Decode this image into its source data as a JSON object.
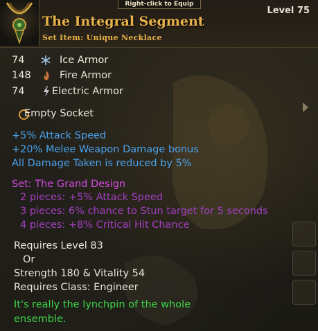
{
  "hint": "Right-click to Equip",
  "item": {
    "name": "The Integral Segment",
    "type": "Set Item: Unique Necklace",
    "level": "Level 75"
  },
  "armor": [
    {
      "value": "74",
      "icon": "snowflake-icon",
      "label": "Ice Armor",
      "color": "#9fc6e6"
    },
    {
      "value": "148",
      "icon": "flame-icon",
      "label": "Fire Armor",
      "color": "#c9773a"
    },
    {
      "value": "74",
      "icon": "lightning-icon",
      "label": "Electric Armor",
      "color": "#c8c8d0"
    }
  ],
  "socket": "Empty Socket",
  "bonuses": [
    "+5% Attack Speed",
    "+20% Melee Weapon Damage bonus",
    "All Damage Taken is reduced by 5%"
  ],
  "set": {
    "name": "Set: The Grand Design",
    "pieces": [
      "2 pieces: +5% Attack Speed",
      "3 pieces: 6% chance to Stun target for 5 seconds",
      "4 pieces: +8% Critical Hit Chance"
    ]
  },
  "requirements": {
    "level": "Requires Level 83",
    "or": "Or",
    "stats": "Strength 180 & Vitality 54",
    "class": "Requires Class: Engineer"
  },
  "flavor": {
    "line1": "It's really the lynchpin of the whole",
    "line2": "ensemble."
  },
  "colors": {
    "title": "#e9b24a",
    "blue_stat": "#4aa3ee",
    "set_name": "#d24be0",
    "set_piece": "#a23fc0",
    "flavor": "#3fd44a"
  }
}
